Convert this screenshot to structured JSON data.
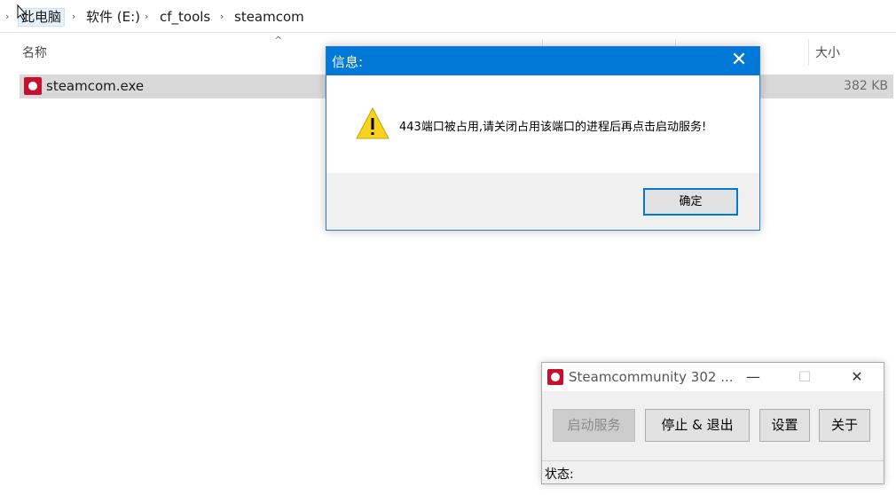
{
  "explorer": {
    "breadcrumb": [
      "此电脑",
      "软件 (E:)",
      "cf_tools",
      "steamcom"
    ],
    "columns": {
      "name": "名称",
      "size": "大小"
    },
    "file": {
      "name": "steamcom.exe",
      "size": "382 KB"
    }
  },
  "dialog": {
    "title": "信息:",
    "message": "443端口被占用,请关闭占用该端口的进程后再点击启动服务!",
    "ok_label": "确定",
    "close_glyph": "✕"
  },
  "app_window": {
    "title": "Steamcommunity 302 ...",
    "minimize_glyph": "—",
    "maximize_glyph": "☐",
    "close_glyph": "✕",
    "buttons": {
      "start": "启动服务",
      "stop_exit": "停止 & 退出",
      "settings": "设置",
      "about": "关于"
    },
    "status_label": "状态:"
  },
  "colors": {
    "dialog_title_bg": "#0078d7",
    "selection_bg": "#d9d9d9",
    "brand_red": "#c8102e"
  }
}
